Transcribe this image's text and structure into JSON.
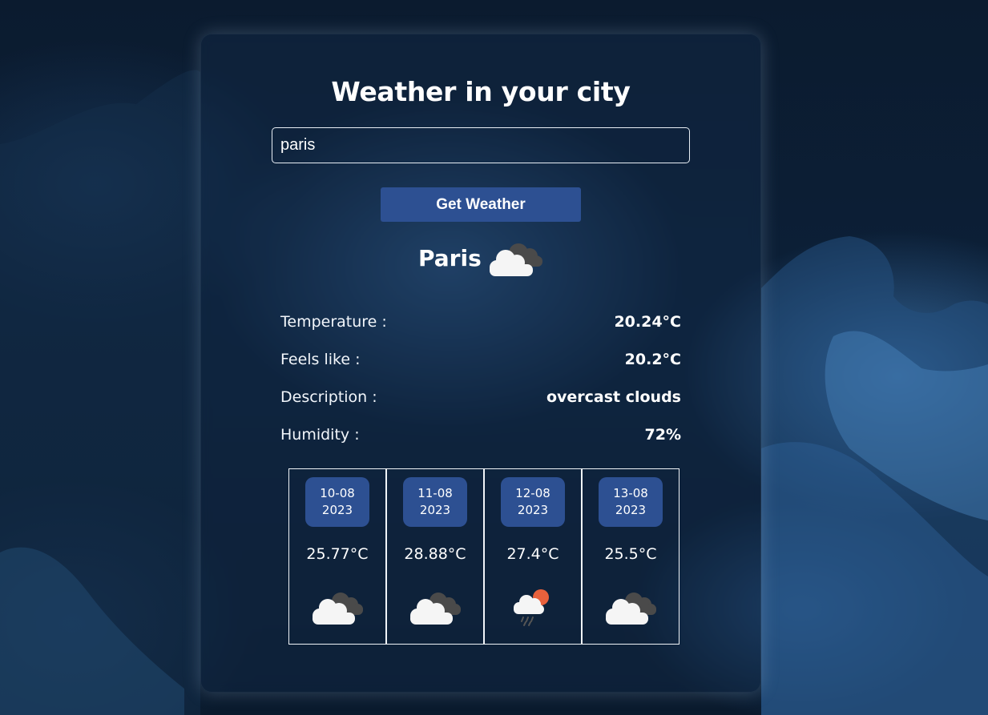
{
  "header": {
    "title": "Weather in your city"
  },
  "search": {
    "value": "paris",
    "placeholder": ""
  },
  "actions": {
    "get_weather_label": "Get Weather"
  },
  "current": {
    "city": "Paris",
    "icon": "overcast-clouds-icon",
    "rows": [
      {
        "label": "Temperature :",
        "value": "20.24°C"
      },
      {
        "label": "Feels like :",
        "value": "20.2°C"
      },
      {
        "label": "Description :",
        "value": "overcast clouds"
      },
      {
        "label": "Humidity :",
        "value": "72%"
      }
    ]
  },
  "forecast": [
    {
      "date_line1": "10-08",
      "date_line2": "2023",
      "temp": "25.77°C",
      "icon": "overcast-clouds-icon"
    },
    {
      "date_line1": "11-08",
      "date_line2": "2023",
      "temp": "28.88°C",
      "icon": "overcast-clouds-icon"
    },
    {
      "date_line1": "12-08",
      "date_line2": "2023",
      "temp": "27.4°C",
      "icon": "sun-cloud-rain-icon"
    },
    {
      "date_line1": "13-08",
      "date_line2": "2023",
      "temp": "25.5°C",
      "icon": "overcast-clouds-icon"
    }
  ],
  "colors": {
    "accent": "#2d5092",
    "background": "#0b1b2f",
    "sun": "#e8613c",
    "cloud_light": "#f2f2f2",
    "cloud_dark": "#4a4a4a"
  }
}
